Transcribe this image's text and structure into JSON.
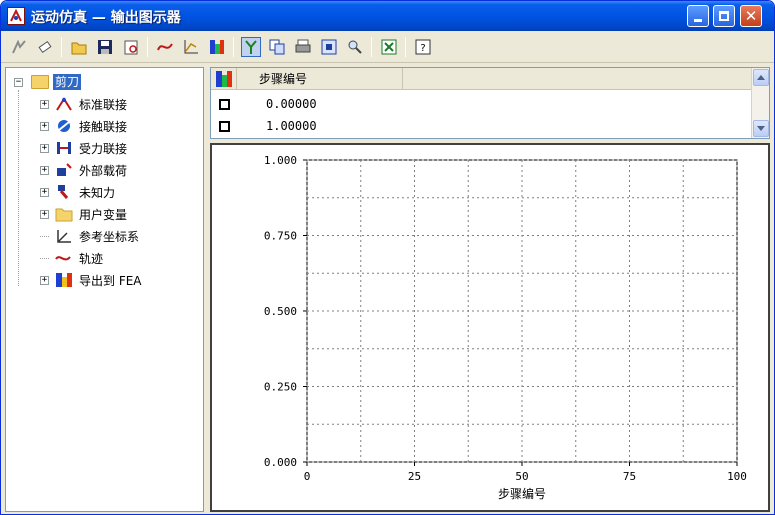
{
  "window": {
    "title": "运动仿真 — 输出图示器"
  },
  "toolbar": {
    "buttons": [
      "create-sim-icon",
      "eraser-icon",
      "open-folder-icon",
      "save-icon",
      "print-preview-icon",
      "curve-icon",
      "axes-chart-icon",
      "color-map-icon",
      "y-axis-icon",
      "copy-icon",
      "print-icon",
      "fit-view-icon",
      "zoom-icon",
      "excel-export-icon",
      "help-icon"
    ],
    "pressed": "y-axis-icon"
  },
  "tree": {
    "root_label": "剪刀",
    "items": [
      {
        "label": "标准联接",
        "icon": "standard-joint-icon",
        "expandable": true
      },
      {
        "label": "接触联接",
        "icon": "contact-joint-icon",
        "expandable": true
      },
      {
        "label": "受力联接",
        "icon": "force-joint-icon",
        "expandable": true
      },
      {
        "label": "外部载荷",
        "icon": "external-load-icon",
        "expandable": true
      },
      {
        "label": "未知力",
        "icon": "unknown-force-icon",
        "expandable": true
      },
      {
        "label": "用户变量",
        "icon": "folder-icon",
        "expandable": true
      },
      {
        "label": "参考坐标系",
        "icon": "coordinate-system-icon",
        "expandable": false
      },
      {
        "label": "轨迹",
        "icon": "trajectory-icon",
        "expandable": false
      },
      {
        "label": "导出到 FEA",
        "icon": "fea-export-icon",
        "expandable": true
      }
    ]
  },
  "list": {
    "column_header": "步骤编号",
    "rows": [
      "0.00000",
      "1.00000"
    ]
  },
  "chart_data": {
    "type": "line",
    "title": "",
    "xlabel": "步骤编号",
    "ylabel": "",
    "xlim": [
      0,
      100
    ],
    "ylim": [
      0,
      1
    ],
    "x_ticks": [
      "0",
      "25",
      "50",
      "75",
      "100"
    ],
    "y_ticks": [
      "0.000",
      "0.250",
      "0.500",
      "0.750",
      "1.000"
    ],
    "grid": true,
    "series": []
  },
  "colors": {
    "titlebar": "#0054e3",
    "selection": "#316ac5",
    "grid": "#808080"
  }
}
